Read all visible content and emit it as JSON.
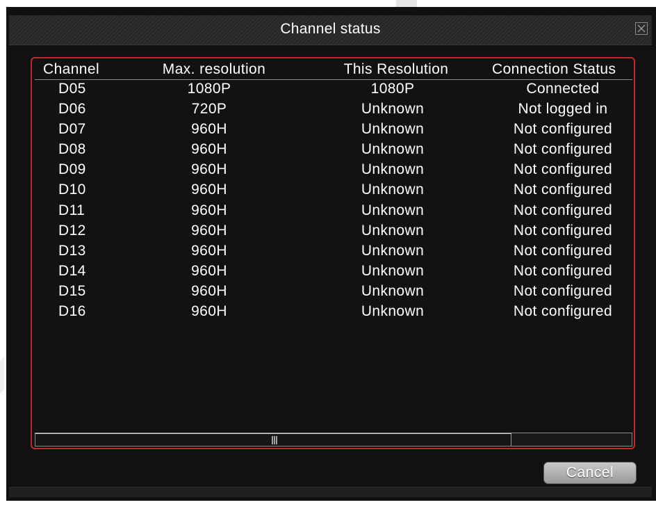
{
  "dialog": {
    "title": "Channel status",
    "cancel_label": "Cancel"
  },
  "table": {
    "columns": [
      "Channel",
      "Max. resolution",
      "This Resolution",
      "Connection Status"
    ],
    "rows": [
      [
        "D05",
        "1080P",
        "1080P",
        "Connected"
      ],
      [
        "D06",
        "720P",
        "Unknown",
        "Not logged in"
      ],
      [
        "D07",
        "960H",
        "Unknown",
        "Not configured"
      ],
      [
        "D08",
        "960H",
        "Unknown",
        "Not configured"
      ],
      [
        "D09",
        "960H",
        "Unknown",
        "Not configured"
      ],
      [
        "D10",
        "960H",
        "Unknown",
        "Not configured"
      ],
      [
        "D11",
        "960H",
        "Unknown",
        "Not configured"
      ],
      [
        "D12",
        "960H",
        "Unknown",
        "Not configured"
      ],
      [
        "D13",
        "960H",
        "Unknown",
        "Not configured"
      ],
      [
        "D14",
        "960H",
        "Unknown",
        "Not configured"
      ],
      [
        "D15",
        "960H",
        "Unknown",
        "Not configured"
      ],
      [
        "D16",
        "960H",
        "Unknown",
        "Not configured"
      ]
    ]
  },
  "colors": {
    "panel_border": "#c0282c",
    "background": "#111111",
    "text": "#ffffff"
  },
  "icons": {
    "close": "close-icon",
    "scroll_grip": "scroll-grip-icon"
  }
}
